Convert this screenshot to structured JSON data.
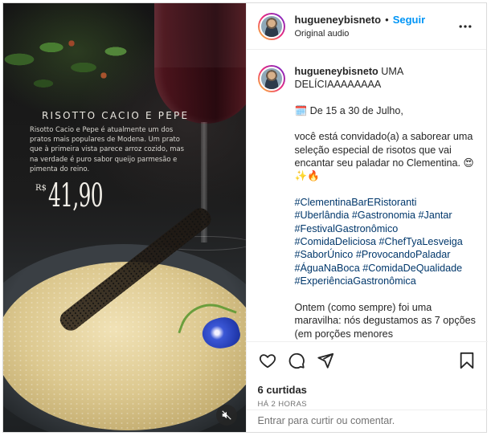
{
  "media": {
    "dish_title": "RISOTTO CACIO E PEPE",
    "dish_description": "Risotto Cacio e Pepe é atualmente um dos pratos mais populares de Modena. Um prato que à primeira vista parece arroz cozido, mas na verdade é puro sabor queijo parmesão e pimenta do reino.",
    "price_currency": "R$",
    "price_value": "41,90",
    "mute_icon": "speaker-muted-icon"
  },
  "header": {
    "username": "hugueneybisneto",
    "separator": "•",
    "follow_label": "Seguir",
    "audio_label": "Original audio",
    "more_icon": "more-horizontal-icon"
  },
  "caption": {
    "username": "hugueneybisneto",
    "intro": "UMA DELÍCIAAAAAAAA",
    "date_line": "🗓️ De 15 a 30 de Julho,",
    "invite": "você está convidado(a) a saborear uma seleção especial de risotos que vai encantar seu paladar no Clementina. 😍✨🔥",
    "hashtags": [
      "#ClementinaBarERistoranti",
      "#Uberlândia",
      "#Gastronomia",
      "#Jantar",
      "#FestivalGastronômico",
      "#ComidaDeliciosa",
      "#ChefTyaLesveiga",
      "#SaborÚnico",
      "#ProvocandoPaladar",
      "#ÁguaNaBoca",
      "#ComidaDeQualidade",
      "#ExperiênciaGastronômica"
    ],
    "followup": "Ontem (como sempre) foi uma maravilha: nós degustamos as 7 opções (em porções menores"
  },
  "actions": {
    "like_icon": "heart-icon",
    "comment_icon": "comment-icon",
    "share_icon": "paper-plane-icon",
    "save_icon": "bookmark-icon",
    "likes_text": "6 curtidas",
    "time_text": "HÁ 2 HORAS"
  },
  "comment_box": {
    "link_text": "Entrar",
    "rest_text": " para curtir ou comentar."
  }
}
